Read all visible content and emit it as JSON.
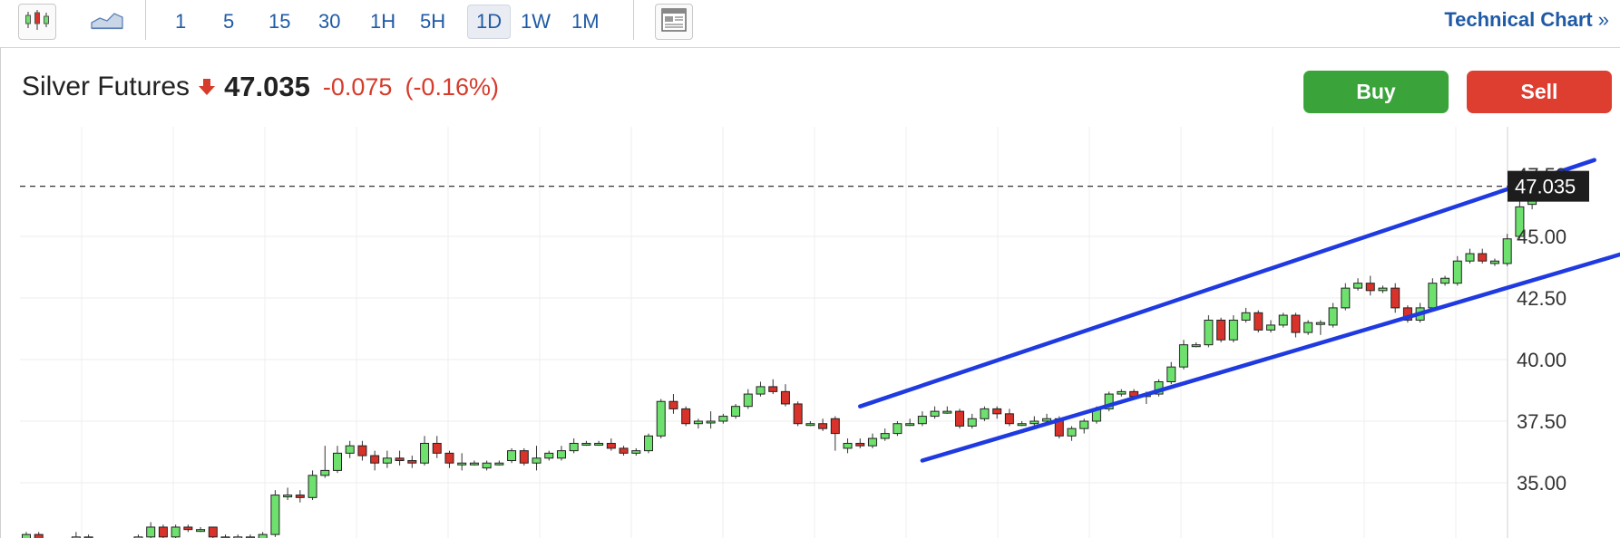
{
  "toolbar": {
    "timeframes": [
      "1",
      "5",
      "15",
      "30",
      "1H",
      "5H",
      "1D",
      "1W",
      "1M"
    ],
    "active_timeframe": "1D",
    "technical_chart_label": "Technical Chart",
    "technical_chart_arrow": "»"
  },
  "header": {
    "instrument": "Silver Futures",
    "price": "47.035",
    "change": "-0.075",
    "change_pct": "(-0.16%)",
    "direction": "down"
  },
  "actions": {
    "buy_label": "Buy",
    "sell_label": "Sell"
  },
  "colors": {
    "up_candle": "#6ee06e",
    "down_candle": "#d9322a",
    "channel_line": "#1f3ae0",
    "buy": "#3aa33a",
    "sell": "#dd3e30",
    "link": "#1f5aa6",
    "negative": "#d63b2b"
  },
  "chart_data": {
    "type": "candlestick",
    "y_ticks": [
      "35.00",
      "37.50",
      "40.00",
      "42.50",
      "45.00"
    ],
    "top_tick_partial": "47.50",
    "ylim": [
      32.6,
      48.6
    ],
    "last_price_label": "47.035",
    "last_price": 47.035,
    "grid": true,
    "candles": [
      [
        32.3,
        32.9,
        32.2,
        33.0
      ],
      [
        32.9,
        32.4,
        32.3,
        33.0
      ],
      [
        32.4,
        32.6,
        32.3,
        32.7
      ],
      [
        32.6,
        32.5,
        32.4,
        32.7
      ],
      [
        32.5,
        32.8,
        32.4,
        33.0
      ],
      [
        32.8,
        32.5,
        32.4,
        32.9
      ],
      [
        32.5,
        32.4,
        32.3,
        32.6
      ],
      [
        32.4,
        32.5,
        32.3,
        32.6
      ],
      [
        32.5,
        32.4,
        32.3,
        32.6
      ],
      [
        32.4,
        32.8,
        32.3,
        32.9
      ],
      [
        32.8,
        33.2,
        32.7,
        33.4
      ],
      [
        33.2,
        32.8,
        32.7,
        33.3
      ],
      [
        32.8,
        33.2,
        32.7,
        33.3
      ],
      [
        33.2,
        33.1,
        33.0,
        33.3
      ],
      [
        33.1,
        33.1,
        33.0,
        33.2
      ],
      [
        33.2,
        32.8,
        32.7,
        33.2
      ],
      [
        32.8,
        32.6,
        32.5,
        32.9
      ],
      [
        32.6,
        32.8,
        32.5,
        32.9
      ],
      [
        32.8,
        32.6,
        32.5,
        32.9
      ],
      [
        32.6,
        32.9,
        32.5,
        33.0
      ],
      [
        32.9,
        34.5,
        32.8,
        34.7
      ],
      [
        34.5,
        34.5,
        34.3,
        34.8
      ],
      [
        34.5,
        34.4,
        34.2,
        34.7
      ],
      [
        34.4,
        35.3,
        34.3,
        35.5
      ],
      [
        35.3,
        35.5,
        35.2,
        36.5
      ],
      [
        35.5,
        36.2,
        35.4,
        36.5
      ],
      [
        36.2,
        36.5,
        36.0,
        36.7
      ],
      [
        36.5,
        36.1,
        35.9,
        36.7
      ],
      [
        36.1,
        35.8,
        35.5,
        36.3
      ],
      [
        35.8,
        36.0,
        35.6,
        36.3
      ],
      [
        36.0,
        35.9,
        35.7,
        36.3
      ],
      [
        35.9,
        35.8,
        35.6,
        36.1
      ],
      [
        35.8,
        36.6,
        35.7,
        36.9
      ],
      [
        36.6,
        36.2,
        36.0,
        36.9
      ],
      [
        36.2,
        35.8,
        35.6,
        36.3
      ],
      [
        35.8,
        35.8,
        35.5,
        36.2
      ],
      [
        35.8,
        35.8,
        35.7,
        35.9
      ],
      [
        35.6,
        35.8,
        35.5,
        35.9
      ],
      [
        35.8,
        35.8,
        35.7,
        35.9
      ],
      [
        35.9,
        36.3,
        35.8,
        36.4
      ],
      [
        36.3,
        35.8,
        35.7,
        36.4
      ],
      [
        35.8,
        36.0,
        35.5,
        36.5
      ],
      [
        36.0,
        36.2,
        35.9,
        36.3
      ],
      [
        36.0,
        36.3,
        35.9,
        36.5
      ],
      [
        36.3,
        36.6,
        36.2,
        36.8
      ],
      [
        36.6,
        36.6,
        36.5,
        36.7
      ],
      [
        36.6,
        36.6,
        36.5,
        36.7
      ],
      [
        36.6,
        36.4,
        36.3,
        36.8
      ],
      [
        36.4,
        36.2,
        36.1,
        36.5
      ],
      [
        36.2,
        36.3,
        36.1,
        36.4
      ],
      [
        36.3,
        36.9,
        36.2,
        37.0
      ],
      [
        36.9,
        38.3,
        36.8,
        38.4
      ],
      [
        38.3,
        38.0,
        37.8,
        38.6
      ],
      [
        38.0,
        37.4,
        37.3,
        38.1
      ],
      [
        37.4,
        37.5,
        37.2,
        37.6
      ],
      [
        37.5,
        37.5,
        37.2,
        37.9
      ],
      [
        37.5,
        37.7,
        37.4,
        37.8
      ],
      [
        37.7,
        38.1,
        37.6,
        38.2
      ],
      [
        38.1,
        38.6,
        38.0,
        38.8
      ],
      [
        38.6,
        38.9,
        38.5,
        39.1
      ],
      [
        38.9,
        38.7,
        38.6,
        39.2
      ],
      [
        38.7,
        38.2,
        38.1,
        39.0
      ],
      [
        38.2,
        37.4,
        37.3,
        38.3
      ],
      [
        37.4,
        37.4,
        37.3,
        37.5
      ],
      [
        37.4,
        37.2,
        37.1,
        37.6
      ],
      [
        37.6,
        37.0,
        36.3,
        37.7
      ],
      [
        36.4,
        36.6,
        36.2,
        36.8
      ],
      [
        36.6,
        36.5,
        36.4,
        36.8
      ],
      [
        36.5,
        36.8,
        36.4,
        37.0
      ],
      [
        36.8,
        37.0,
        36.7,
        37.2
      ],
      [
        37.0,
        37.4,
        36.9,
        37.5
      ],
      [
        37.4,
        37.4,
        37.3,
        37.6
      ],
      [
        37.4,
        37.7,
        37.3,
        37.9
      ],
      [
        37.7,
        37.9,
        37.6,
        38.1
      ],
      [
        37.9,
        37.9,
        37.8,
        38.1
      ],
      [
        37.9,
        37.3,
        37.2,
        38.0
      ],
      [
        37.3,
        37.6,
        37.2,
        37.8
      ],
      [
        37.6,
        38.0,
        37.5,
        38.1
      ],
      [
        38.0,
        37.8,
        37.6,
        38.1
      ],
      [
        37.8,
        37.4,
        37.3,
        38.0
      ],
      [
        37.4,
        37.4,
        37.3,
        37.5
      ],
      [
        37.4,
        37.5,
        37.3,
        37.7
      ],
      [
        37.5,
        37.6,
        37.4,
        37.8
      ],
      [
        37.6,
        36.9,
        36.8,
        37.7
      ],
      [
        36.9,
        37.2,
        36.7,
        37.3
      ],
      [
        37.2,
        37.5,
        37.0,
        37.6
      ],
      [
        37.5,
        38.0,
        37.4,
        38.1
      ],
      [
        38.0,
        38.6,
        37.9,
        38.7
      ],
      [
        38.6,
        38.7,
        38.5,
        38.8
      ],
      [
        38.7,
        38.5,
        38.4,
        38.8
      ],
      [
        38.5,
        38.6,
        38.2,
        38.7
      ],
      [
        38.6,
        39.1,
        38.5,
        39.2
      ],
      [
        39.1,
        39.7,
        39.0,
        39.9
      ],
      [
        39.7,
        40.6,
        39.6,
        40.8
      ],
      [
        40.6,
        40.6,
        40.5,
        40.7
      ],
      [
        40.6,
        41.6,
        40.5,
        41.8
      ],
      [
        41.6,
        40.8,
        40.7,
        41.7
      ],
      [
        40.8,
        41.6,
        40.7,
        41.8
      ],
      [
        41.6,
        41.9,
        41.5,
        42.1
      ],
      [
        41.9,
        41.2,
        41.1,
        42.0
      ],
      [
        41.2,
        41.4,
        41.1,
        41.6
      ],
      [
        41.4,
        41.8,
        41.3,
        41.9
      ],
      [
        41.8,
        41.1,
        40.9,
        41.9
      ],
      [
        41.1,
        41.5,
        41.0,
        41.6
      ],
      [
        41.5,
        41.5,
        41.0,
        41.6
      ],
      [
        41.4,
        42.1,
        41.3,
        42.3
      ],
      [
        42.1,
        42.9,
        42.0,
        43.1
      ],
      [
        42.9,
        43.1,
        42.8,
        43.3
      ],
      [
        43.1,
        42.8,
        42.6,
        43.4
      ],
      [
        42.8,
        42.9,
        42.7,
        43.0
      ],
      [
        42.9,
        42.1,
        41.9,
        43.1
      ],
      [
        42.1,
        41.6,
        41.5,
        42.2
      ],
      [
        41.6,
        42.1,
        41.5,
        42.3
      ],
      [
        42.1,
        43.1,
        42.0,
        43.3
      ],
      [
        43.1,
        43.3,
        43.0,
        43.4
      ],
      [
        43.1,
        44.0,
        43.0,
        44.2
      ],
      [
        44.0,
        44.3,
        43.9,
        44.5
      ],
      [
        44.3,
        44.0,
        43.9,
        44.5
      ],
      [
        43.9,
        44.0,
        43.8,
        44.1
      ],
      [
        43.9,
        44.9,
        43.8,
        45.1
      ],
      [
        45.0,
        46.2,
        44.9,
        46.6
      ],
      [
        46.3,
        46.7,
        46.1,
        47.5
      ]
    ],
    "annotations": {
      "ascending_channel": {
        "upper_line": [
          [
            67,
            38.1
          ],
          [
            126,
            48.1
          ]
        ],
        "lower_line": [
          [
            72,
            35.9
          ],
          [
            137,
            45.6
          ]
        ]
      }
    }
  }
}
